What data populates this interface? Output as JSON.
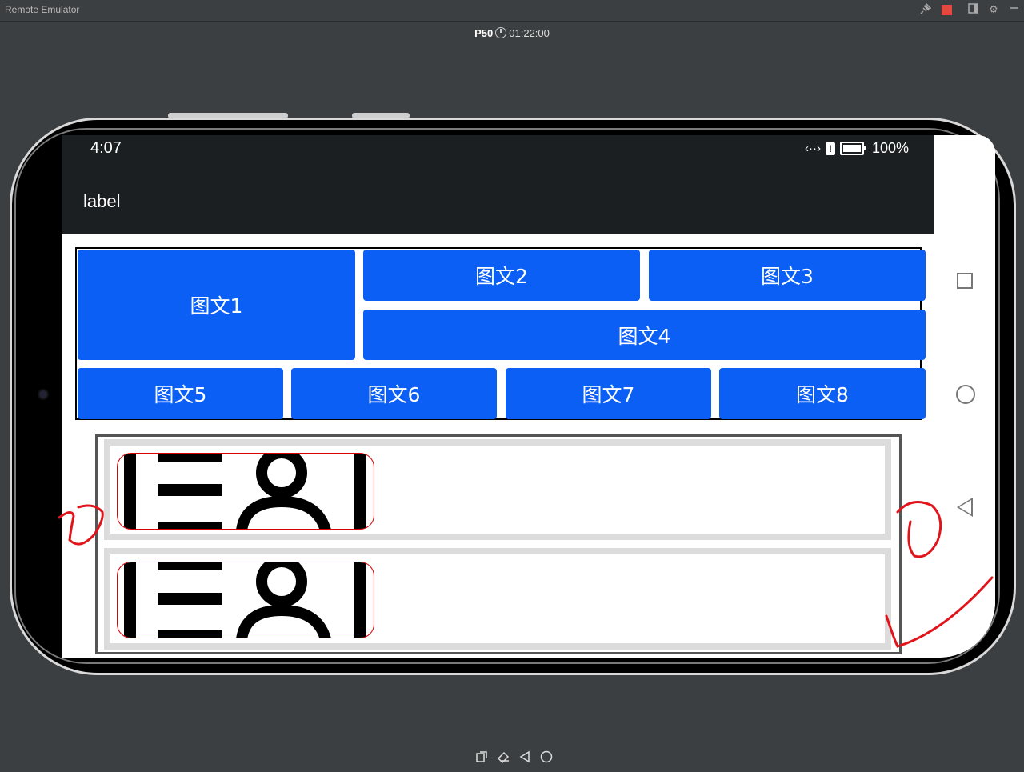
{
  "window": {
    "title": "Remote Emulator"
  },
  "device": {
    "name": "P50",
    "timer": "01:22:00"
  },
  "status_bar": {
    "time": "4:07",
    "battery": "100%",
    "alert": "!"
  },
  "app": {
    "title": "label"
  },
  "grid": {
    "items": [
      "图文1",
      "图文2",
      "图文3",
      "图文4",
      "图文5",
      "图文6",
      "图文7",
      "图文8"
    ]
  },
  "list": {
    "items": [
      {
        "icon": "contact-card-icon"
      },
      {
        "icon": "contact-card-icon"
      }
    ]
  },
  "colors": {
    "tile_blue": "#0b5ff4",
    "status_bar": "#1b1f21",
    "annotation_red": "#e0141a",
    "ide_bg": "#3c3f41"
  }
}
